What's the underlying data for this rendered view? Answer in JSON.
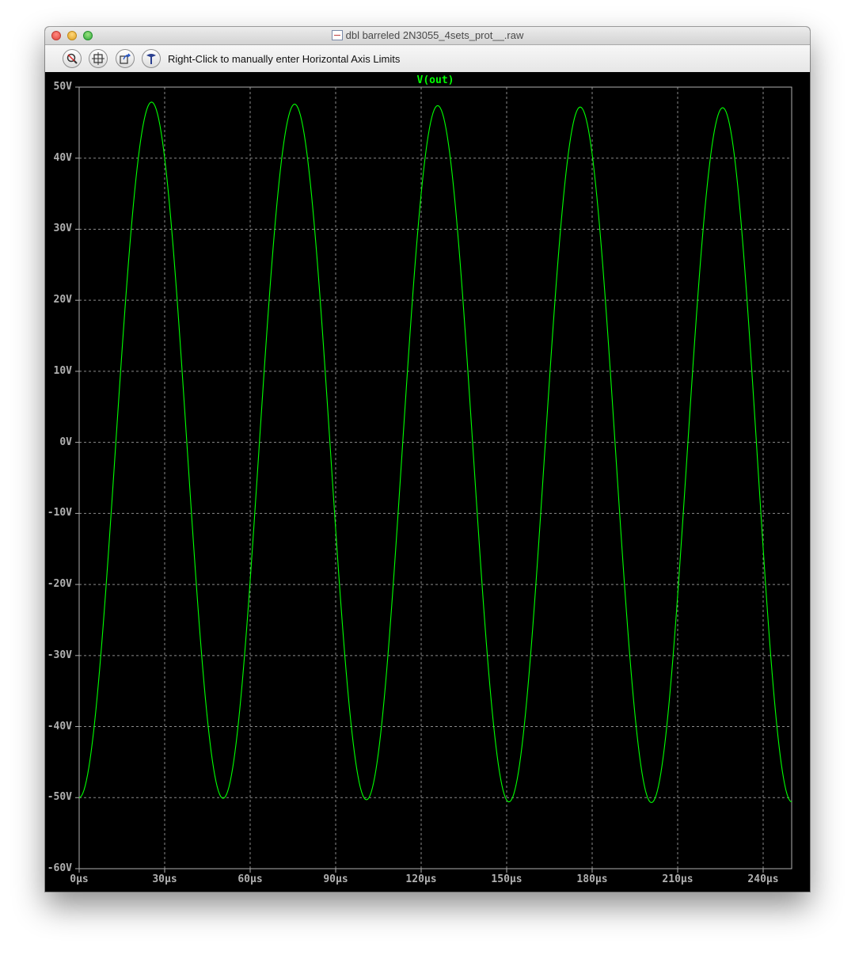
{
  "window": {
    "title": "dbl barreled 2N3055_4sets_prot__.raw",
    "title_icon": "waveform-file-icon"
  },
  "toolbar": {
    "buttons": [
      {
        "name": "zoom-icon"
      },
      {
        "name": "autorange-icon"
      },
      {
        "name": "undo-zoom-icon"
      },
      {
        "name": "tools-icon"
      }
    ],
    "hint": "Right-Click to manually enter Horizontal Axis Limits"
  },
  "chart_data": {
    "type": "line",
    "title": "V(out)",
    "title_color": "#00ff00",
    "line_color": "#00ff00",
    "background": "#000000",
    "grid": true,
    "xlim": [
      0,
      250
    ],
    "ylim": [
      -60,
      50
    ],
    "xticks": [
      0,
      30,
      60,
      90,
      120,
      150,
      180,
      210,
      240
    ],
    "xtick_labels": [
      "0µs",
      "30µs",
      "60µs",
      "90µs",
      "120µs",
      "150µs",
      "180µs",
      "210µs",
      "240µs"
    ],
    "yticks": [
      50,
      40,
      30,
      20,
      10,
      0,
      -10,
      -20,
      -30,
      -40,
      -50,
      -60
    ],
    "ytick_labels": [
      "50V",
      "40V",
      "30V",
      "20V",
      "10V",
      "0V",
      "-10V",
      "-20V",
      "-30V",
      "-40V",
      "-50V",
      "-60V"
    ],
    "series": [
      {
        "name": "V(out)",
        "x": [
          0,
          25.4,
          50.5,
          75.6,
          100.8,
          125.8,
          150.8,
          175.8,
          200.8,
          225.8,
          250
        ],
        "y": [
          -50.0,
          47.9,
          -50.1,
          47.6,
          -50.3,
          47.4,
          -50.6,
          47.2,
          -50.7,
          47.1,
          -50.6
        ]
      }
    ]
  }
}
